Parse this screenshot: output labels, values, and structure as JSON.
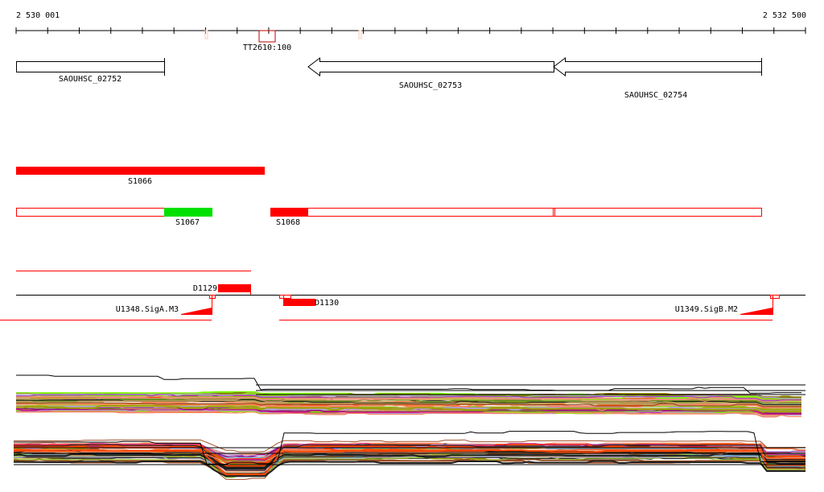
{
  "ruler": {
    "start_label": "2 530 001",
    "end_label": "2 532 500",
    "tick_count": 25
  },
  "terminator": {
    "label": "TT2610:100"
  },
  "genes": [
    {
      "label": "SAOUHSC_02752",
      "strand": "+"
    },
    {
      "label": "SAOUHSC_02753",
      "strand": "-"
    },
    {
      "label": "SAOUHSC_02754",
      "strand": "-"
    }
  ],
  "segments": [
    {
      "label": "S1066"
    },
    {
      "label": "S1067"
    },
    {
      "label": "S1068"
    }
  ],
  "deletions": [
    {
      "label": "D1129"
    },
    {
      "label": "D1130"
    }
  ],
  "promoters": [
    {
      "label": "U1348.SigA.M3"
    },
    {
      "label": "U1349.SigB.M2"
    }
  ],
  "colors": {
    "feature_red": "#ff0000",
    "feature_green": "#00e000",
    "terminator": "#c00000",
    "faint_marker": "#f8c8b8",
    "traces": [
      "#000000",
      "#5ab4e6",
      "#b39ddb",
      "#808000",
      "#e8907a",
      "#8b008b",
      "#7cfc00",
      "#d2691e",
      "#ff4500",
      "#a0522d",
      "#6b8e23",
      "#c71585",
      "#1e1e1e",
      "#c0a060",
      "#ff7f50",
      "#9acd32",
      "#9932cc",
      "#8b4513",
      "#a0a000",
      "#e9967a"
    ]
  }
}
